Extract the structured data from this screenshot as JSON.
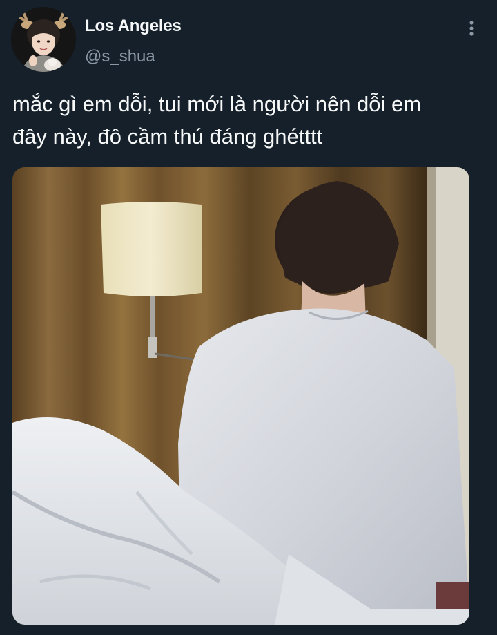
{
  "author": {
    "display_name": "Los Angeles",
    "handle": "@s_shua",
    "avatar_icon": "profile-photo"
  },
  "menu": {
    "icon": "more-vertical-icon"
  },
  "tweet": {
    "text_line1": "mắc gì em dỗi, tui mới là người nên dỗi em",
    "text_line2": "đây này, đô cầm thú đáng ghétttt"
  },
  "media": {
    "type": "photo",
    "icon": "photo-image"
  },
  "colors": {
    "background": "#15202b",
    "primary_text": "#f7f9f9",
    "secondary_text": "#8b98a5"
  }
}
